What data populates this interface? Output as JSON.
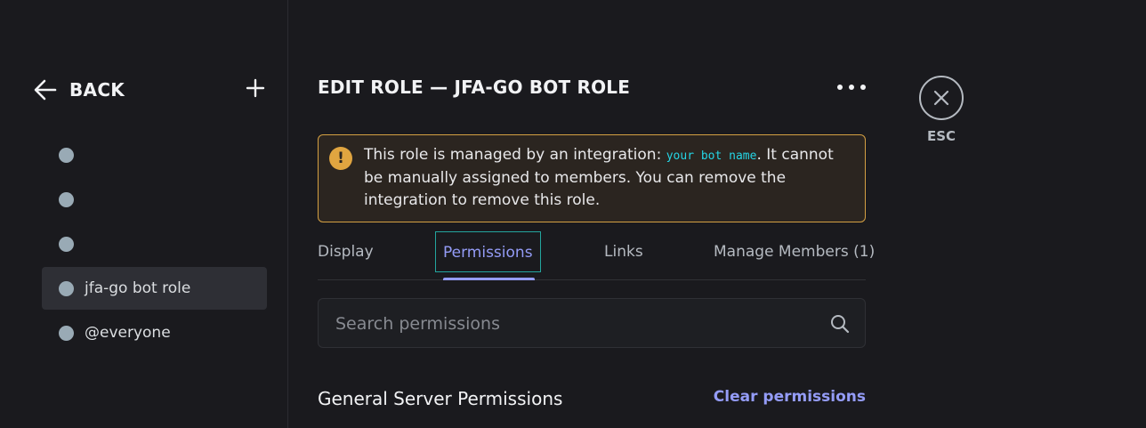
{
  "sidebar": {
    "back_label": "BACK",
    "roles": [
      {
        "name": "",
        "selected": false
      },
      {
        "name": "",
        "selected": false
      },
      {
        "name": "",
        "selected": false
      },
      {
        "name": "jfa-go bot role",
        "selected": true
      },
      {
        "name": "@everyone",
        "selected": false
      }
    ],
    "role_color": "#99aab5"
  },
  "main": {
    "title": "EDIT ROLE — JFA-GO BOT ROLE",
    "notice": {
      "text_before": "This role is managed by an integration: ",
      "integration_name": "your bot name",
      "text_after": ". It cannot be manually assigned to members. You can remove the integration to remove this role.",
      "icon": "!"
    },
    "tabs": [
      {
        "label": "Display",
        "active": false
      },
      {
        "label": "Permissions",
        "active": true
      },
      {
        "label": "Links",
        "active": false
      },
      {
        "label": "Manage Members (1)",
        "active": false
      }
    ],
    "search": {
      "placeholder": "Search permissions",
      "value": ""
    },
    "section_title": "General Server Permissions",
    "clear_label": "Clear permissions"
  },
  "close": {
    "label": "ESC"
  },
  "colors": {
    "accent": "#949cf7",
    "warning_border": "#d4a043",
    "warning_icon": "#e0a540",
    "integration_text": "#25d5e5"
  }
}
